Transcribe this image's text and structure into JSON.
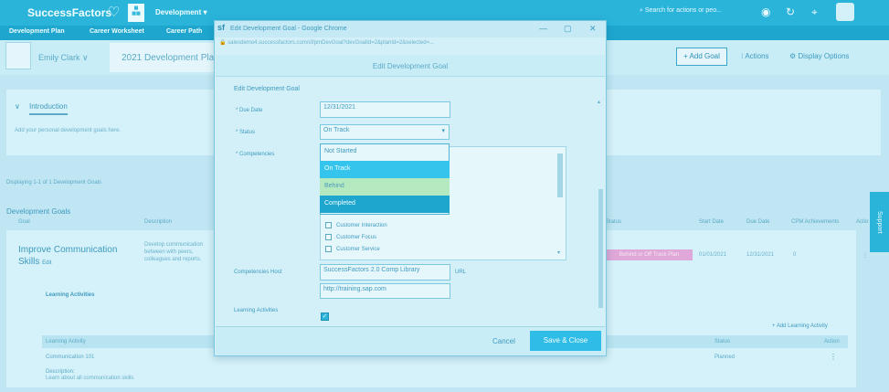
{
  "topbar": {
    "logo": "SuccessFactors",
    "module": "Development ▾",
    "search_placeholder": "Search for actions or peo..."
  },
  "nav": [
    "Development Plan",
    "Career Worksheet",
    "Career Path"
  ],
  "header": {
    "employee": "Emily Clark  ∨",
    "plan_name": "2021 Development Pla",
    "add_goal": "+ Add Goal",
    "actions": "⁝ Actions",
    "display_options": "⚙ Display Options"
  },
  "intro": {
    "title": "Introduction",
    "text": "Add your personal development goals here."
  },
  "goals": {
    "displaying": "Displaying 1-1 of 1 Development Goals",
    "section_title": "Development Goals",
    "columns": [
      "Goal",
      "Description",
      "Status",
      "Start Date",
      "Due Date",
      "CPM Achievements",
      "Actio"
    ],
    "goal": {
      "name": "Improve Communication Skills",
      "edit": "Edit",
      "description": "Develop communication between with peers, colleagues and reports.",
      "status": "Behind or Off Track Plan",
      "start_date": "01/01/2021",
      "due_date": "12/31/2021",
      "cpm": "0"
    },
    "learning": {
      "title": "Learning Activities",
      "add": "+ Add Learning Activity",
      "col_activity": "Learning Activity",
      "col_status": "Status",
      "col_action": "Action",
      "row_name": "Communication 101",
      "row_status": "Planned",
      "desc_label": "Description:",
      "desc": "Learn about all communication skills"
    },
    "support": "Support"
  },
  "popup": {
    "window_title": "Edit Development Goal - Google Chrome",
    "url": "salesdemo4.successfactors.com/sf/pmDevGoal?devGoalId=2&planId=2&selected=...",
    "dialog_title": "Edit Development Goal",
    "form_title": "Edit Development Goal",
    "due_label": "* Due Date",
    "due_value": "12/31/2021",
    "status_label": "* Status",
    "status_value": "On Track",
    "status_options": [
      "Not Started",
      "On Track",
      "Behind",
      "Completed"
    ],
    "competencies_label": "* Competencies",
    "competencies": [
      "Customer Interaction",
      "Customer Focus",
      "Customer Service"
    ],
    "comp_host_label": "Competencies Host",
    "comp_host_value": "SuccessFactors 2.0 Comp Library",
    "comp_host_link": "URL",
    "comp_host_url": "http://training.sap.com",
    "learning_label": "Learning Activities",
    "cancel": "Cancel",
    "save_close": "Save & Close"
  },
  "colors": {
    "brand": "#2ab4da",
    "selected_option": "#34c4ec",
    "hover_option": "#b5e9c0",
    "completed_option": "#1ea6cf",
    "status_badge": "#e0a8d8"
  }
}
